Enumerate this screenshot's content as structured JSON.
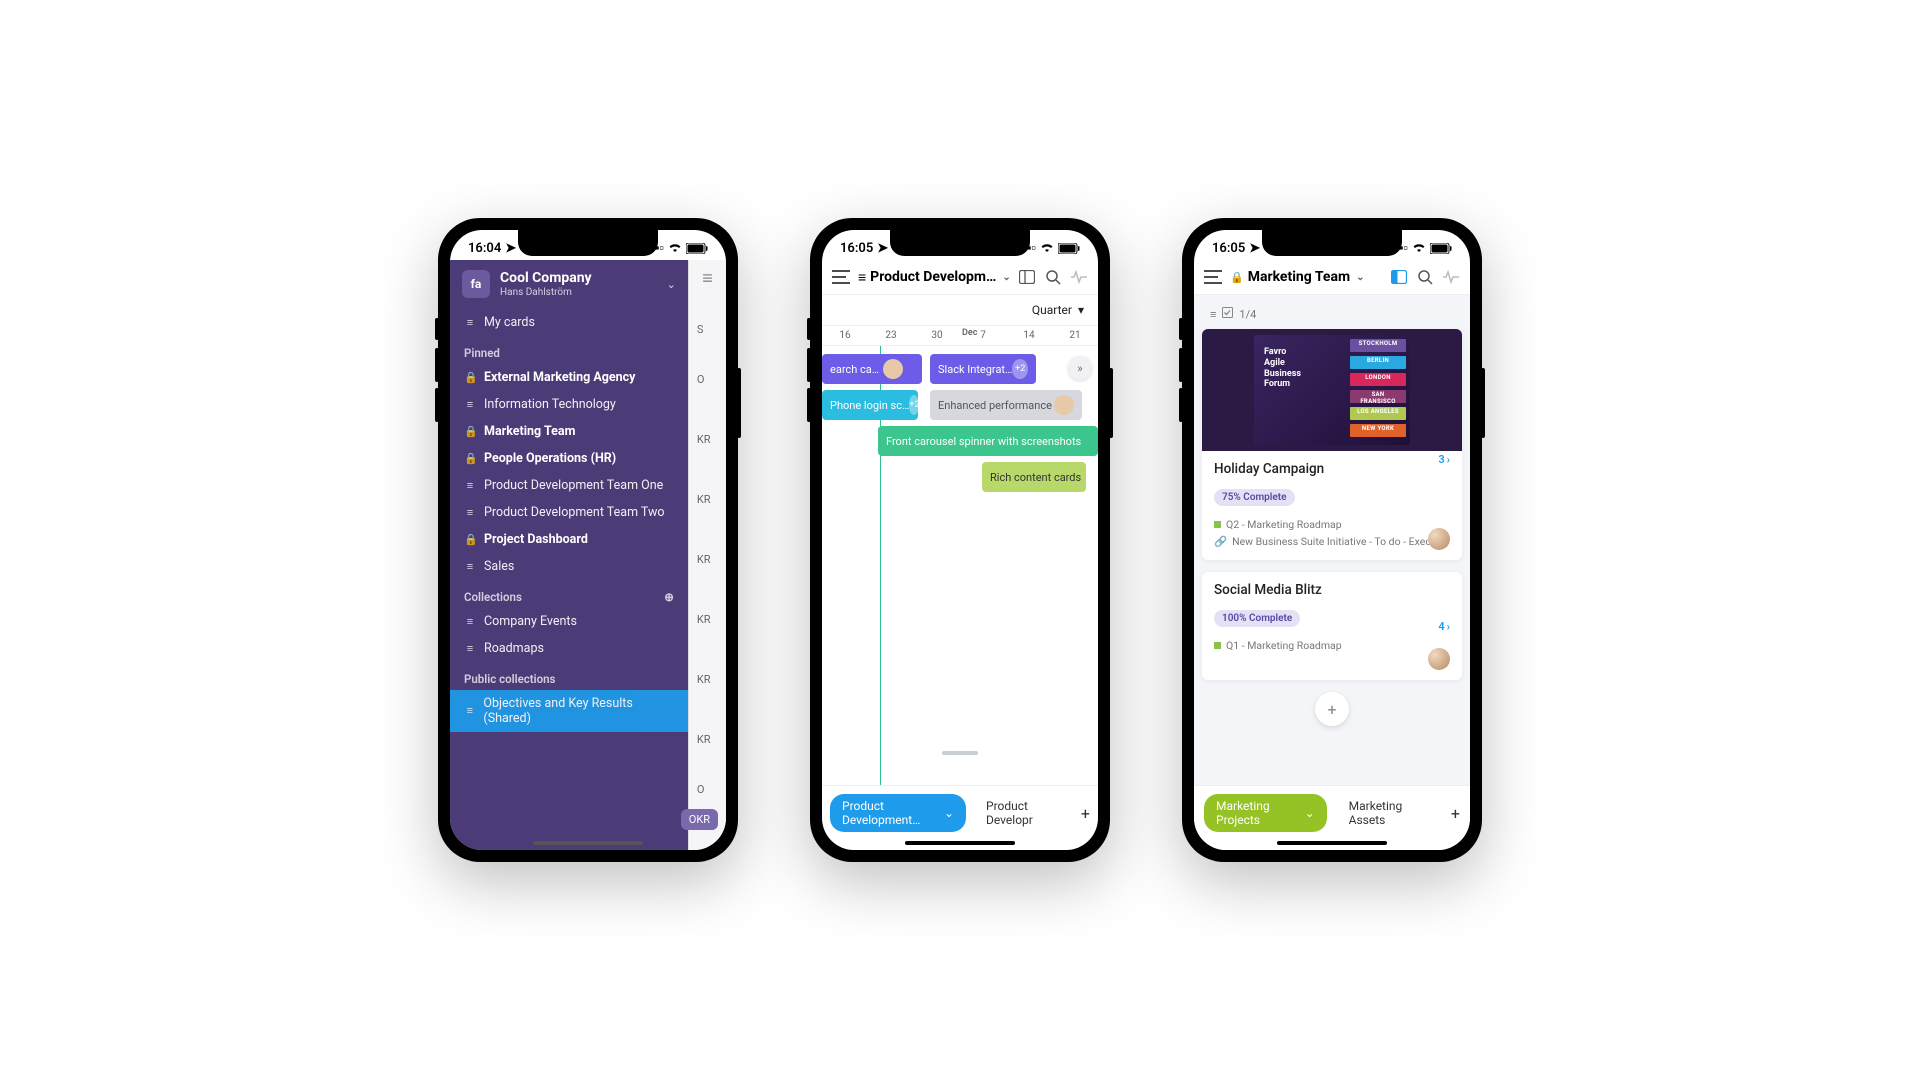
{
  "phone1": {
    "time": "16:04",
    "company": "Cool Company",
    "user": "Hans Dahlström",
    "my_cards": "My cards",
    "pinned_label": "Pinned",
    "pinned": [
      {
        "icon": "lock",
        "label": "External Marketing Agency",
        "bold": true
      },
      {
        "icon": "list",
        "label": "Information Technology",
        "bold": false
      },
      {
        "icon": "lock",
        "label": "Marketing Team",
        "bold": true
      },
      {
        "icon": "lock",
        "label": "People Operations (HR)",
        "bold": true
      },
      {
        "icon": "list",
        "label": "Product Development Team One",
        "bold": false
      },
      {
        "icon": "list",
        "label": "Product Development Team Two",
        "bold": false
      },
      {
        "icon": "lock",
        "label": "Project Dashboard",
        "bold": true
      },
      {
        "icon": "list",
        "label": "Sales",
        "bold": false
      }
    ],
    "collections_label": "Collections",
    "collections": [
      {
        "label": "Company Events"
      },
      {
        "label": "Roadmaps"
      }
    ],
    "public_label": "Public collections",
    "public_item": "Objectives and Key Results (Shared)",
    "right_rows": [
      "S",
      "O",
      "KR",
      "KR",
      "KR",
      "KR",
      "KR",
      "KR",
      "O"
    ],
    "okr_chip": "OKR"
  },
  "phone2": {
    "time": "16:05",
    "title": "Product Developm…",
    "range_label": "Quarter",
    "month_label": "Dec",
    "dates": [
      "16",
      "23",
      "30",
      "7",
      "14",
      "21"
    ],
    "tasks": {
      "search": "earch ca…",
      "slack": "Slack Integrat…",
      "slack_badge": "+2",
      "phone_login": "Phone login sc…",
      "phone_badge": "+2",
      "enhanced": "Enhanced performance",
      "carousel": "Front carousel spinner with screenshots",
      "rich": "Rich content cards"
    },
    "chip_active": "Product Development…",
    "chip_other": "Product Developr"
  },
  "phone3": {
    "time": "16:05",
    "title": "Marketing Team",
    "progress": "1/4",
    "poster_text": "Favro\nAgile\nBusiness\nForum",
    "cities": [
      {
        "name": "STOCKHOLM",
        "color": "#6b50a1"
      },
      {
        "name": "BERLIN",
        "color": "#2aa9e0"
      },
      {
        "name": "LONDON",
        "color": "#d6285a"
      },
      {
        "name": "SAN FRANSISCO",
        "color": "#8b3a6f"
      },
      {
        "name": "LOS ANGELES",
        "color": "#b0c850"
      },
      {
        "name": "NEW YORK",
        "color": "#e0622a"
      }
    ],
    "card1": {
      "title": "Holiday Campaign",
      "badge": "75% Complete",
      "count": "3",
      "meta1": "Q2 - Marketing Roadmap",
      "meta2": "New Business Suite Initiative - To do - Exec…"
    },
    "card2": {
      "title": "Social Media Blitz",
      "badge": "100% Complete",
      "count": "4",
      "meta1": "Q1 - Marketing Roadmap"
    },
    "chip_active": "Marketing Projects",
    "chip_other": "Marketing Assets"
  }
}
